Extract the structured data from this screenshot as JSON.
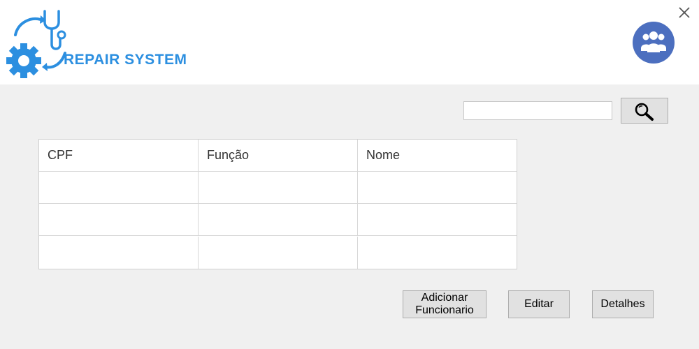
{
  "header": {
    "logo_text": "REPAIR SYSTEM",
    "icons": {
      "logo": "stethoscope-gear-logo",
      "close": "close-icon",
      "users": "users-group-icon"
    },
    "colors": {
      "logo_blue": "#2c8fe0",
      "avatar_bg": "#4c6fbf"
    }
  },
  "search": {
    "value": "",
    "placeholder": "",
    "icon": "search-icon"
  },
  "table": {
    "columns": [
      "CPF",
      "Função",
      "Nome"
    ],
    "rows": [
      [
        "",
        "",
        ""
      ],
      [
        "",
        "",
        ""
      ],
      [
        "",
        "",
        ""
      ]
    ]
  },
  "buttons": {
    "add_line1": "Adicionar",
    "add_line2": "Funcionario",
    "edit": "Editar",
    "details": "Detalhes"
  }
}
